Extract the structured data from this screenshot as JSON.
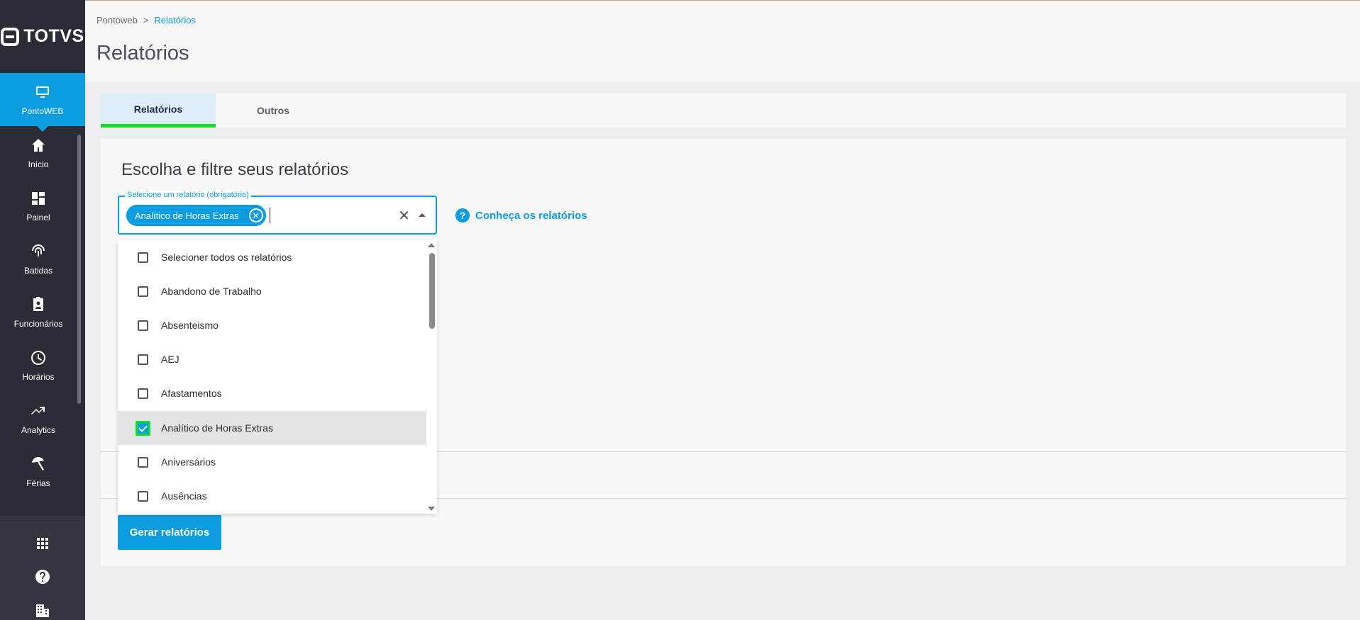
{
  "app": {
    "logo_text": "TOTVS"
  },
  "sidebar": {
    "active": {
      "label": "PontoWEB",
      "icon": "monitor-icon"
    },
    "items": [
      {
        "label": "Início",
        "icon": "home-icon"
      },
      {
        "label": "Painel",
        "icon": "dashboard-icon"
      },
      {
        "label": "Batidas",
        "icon": "fingerprint-icon"
      },
      {
        "label": "Funcionários",
        "icon": "badge-icon"
      },
      {
        "label": "Horários",
        "icon": "clock-icon"
      },
      {
        "label": "Analytics",
        "icon": "trending-up-icon"
      },
      {
        "label": "Férias",
        "icon": "beach-umbrella-icon"
      }
    ],
    "bottom_icons": [
      "apps-grid-icon",
      "help-icon",
      "building-icon"
    ]
  },
  "header": {
    "breadcrumb": {
      "root": "Pontoweb",
      "separator": ">",
      "current": "Relatórios"
    },
    "title": "Relatórios"
  },
  "tabs": [
    {
      "label": "Relatórios",
      "active": true
    },
    {
      "label": "Outros",
      "active": false
    }
  ],
  "main": {
    "section_title": "Escolha e filtre seus relatórios",
    "select": {
      "label": "Selecione um relatório (obrigatório)",
      "chip": "Analítico de Horas Extras",
      "chip_remove": "✕",
      "clear": "✕"
    },
    "help_link": {
      "icon": "?",
      "label": "Conheça os relatórios"
    },
    "generate_button": "Gerar relatórios"
  },
  "dropdown": {
    "items": [
      {
        "label": "Selecioner todos os relatórios",
        "checked": false
      },
      {
        "label": "Abandono de Trabalho",
        "checked": false
      },
      {
        "label": "Absenteismo",
        "checked": false
      },
      {
        "label": "AEJ",
        "checked": false
      },
      {
        "label": "Afastamentos",
        "checked": false
      },
      {
        "label": "Analítico de Horas Extras",
        "checked": true
      },
      {
        "label": "Aniversários",
        "checked": false
      },
      {
        "label": "Ausências",
        "checked": false
      }
    ]
  },
  "colors": {
    "primary": "#0c9ce0",
    "sidebar": "#2a2d35",
    "focus_highlight": "#10e02a"
  }
}
